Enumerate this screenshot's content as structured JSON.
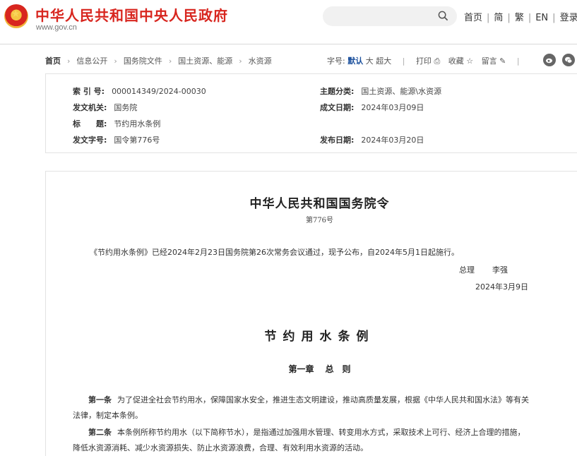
{
  "header": {
    "site_title": "中华人民共和国中央人民政府",
    "site_url": "www.gov.cn",
    "search": {
      "placeholder": "",
      "icon": "search-icon"
    },
    "nav": [
      "首页",
      "简",
      "繁",
      "EN",
      "登录"
    ]
  },
  "breadcrumb": {
    "items": [
      "首页",
      "信息公开",
      "国务院文件",
      "国土资源、能源",
      "水资源"
    ]
  },
  "toolbar": {
    "font_size_label": "字号:",
    "font_sizes": [
      "默认",
      "大",
      "超大"
    ],
    "active_font_size": "默认",
    "print_label": "打印",
    "favorite_label": "收藏",
    "comment_label": "留言",
    "share_icons": [
      "weibo-icon",
      "wechat-icon"
    ]
  },
  "info": {
    "index_no_label": "索 引 号:",
    "index_no": "000014349/2024-00030",
    "topic_label": "主题分类:",
    "topic": "国土资源、能源\\水资源",
    "issuer_label": "发文机关:",
    "issuer": "国务院",
    "written_date_label": "成文日期:",
    "written_date": "2024年03月09日",
    "title_label": "标　　题:",
    "title": "节约用水条例",
    "doc_no_label": "发文字号:",
    "doc_no": "国令第776号",
    "publish_date_label": "发布日期:",
    "publish_date": "2024年03月20日"
  },
  "document": {
    "heading": "中华人民共和国国务院令",
    "order_no": "第776号",
    "intro": "《节约用水条例》已经2024年2月23日国务院第26次常务会议通过，现予公布，自2024年5月1日起施行。",
    "signer_title": "总理",
    "signer_name": "李强",
    "sign_date": "2024年3月9日",
    "regulation_title": "节约用水条例",
    "chapter_no": "第一章",
    "chapter_name": "总　则",
    "articles": [
      {
        "lead": "第一条",
        "line1": "为了促进全社会节约用水，保障国家水安全，推进生态文明建设，推动高质量发展，根据《中华人民共和国水法》等有关",
        "line2": "法律，制定本条例。"
      },
      {
        "lead": "第二条",
        "line1": "本条例所称节约用水（以下简称节水），是指通过加强用水管理、转变用水方式，采取技术上可行、经济上合理的措施，",
        "line2": "降低水资源消耗、减少水资源损失、防止水资源浪费，合理、有效利用水资源的活动。"
      }
    ]
  }
}
